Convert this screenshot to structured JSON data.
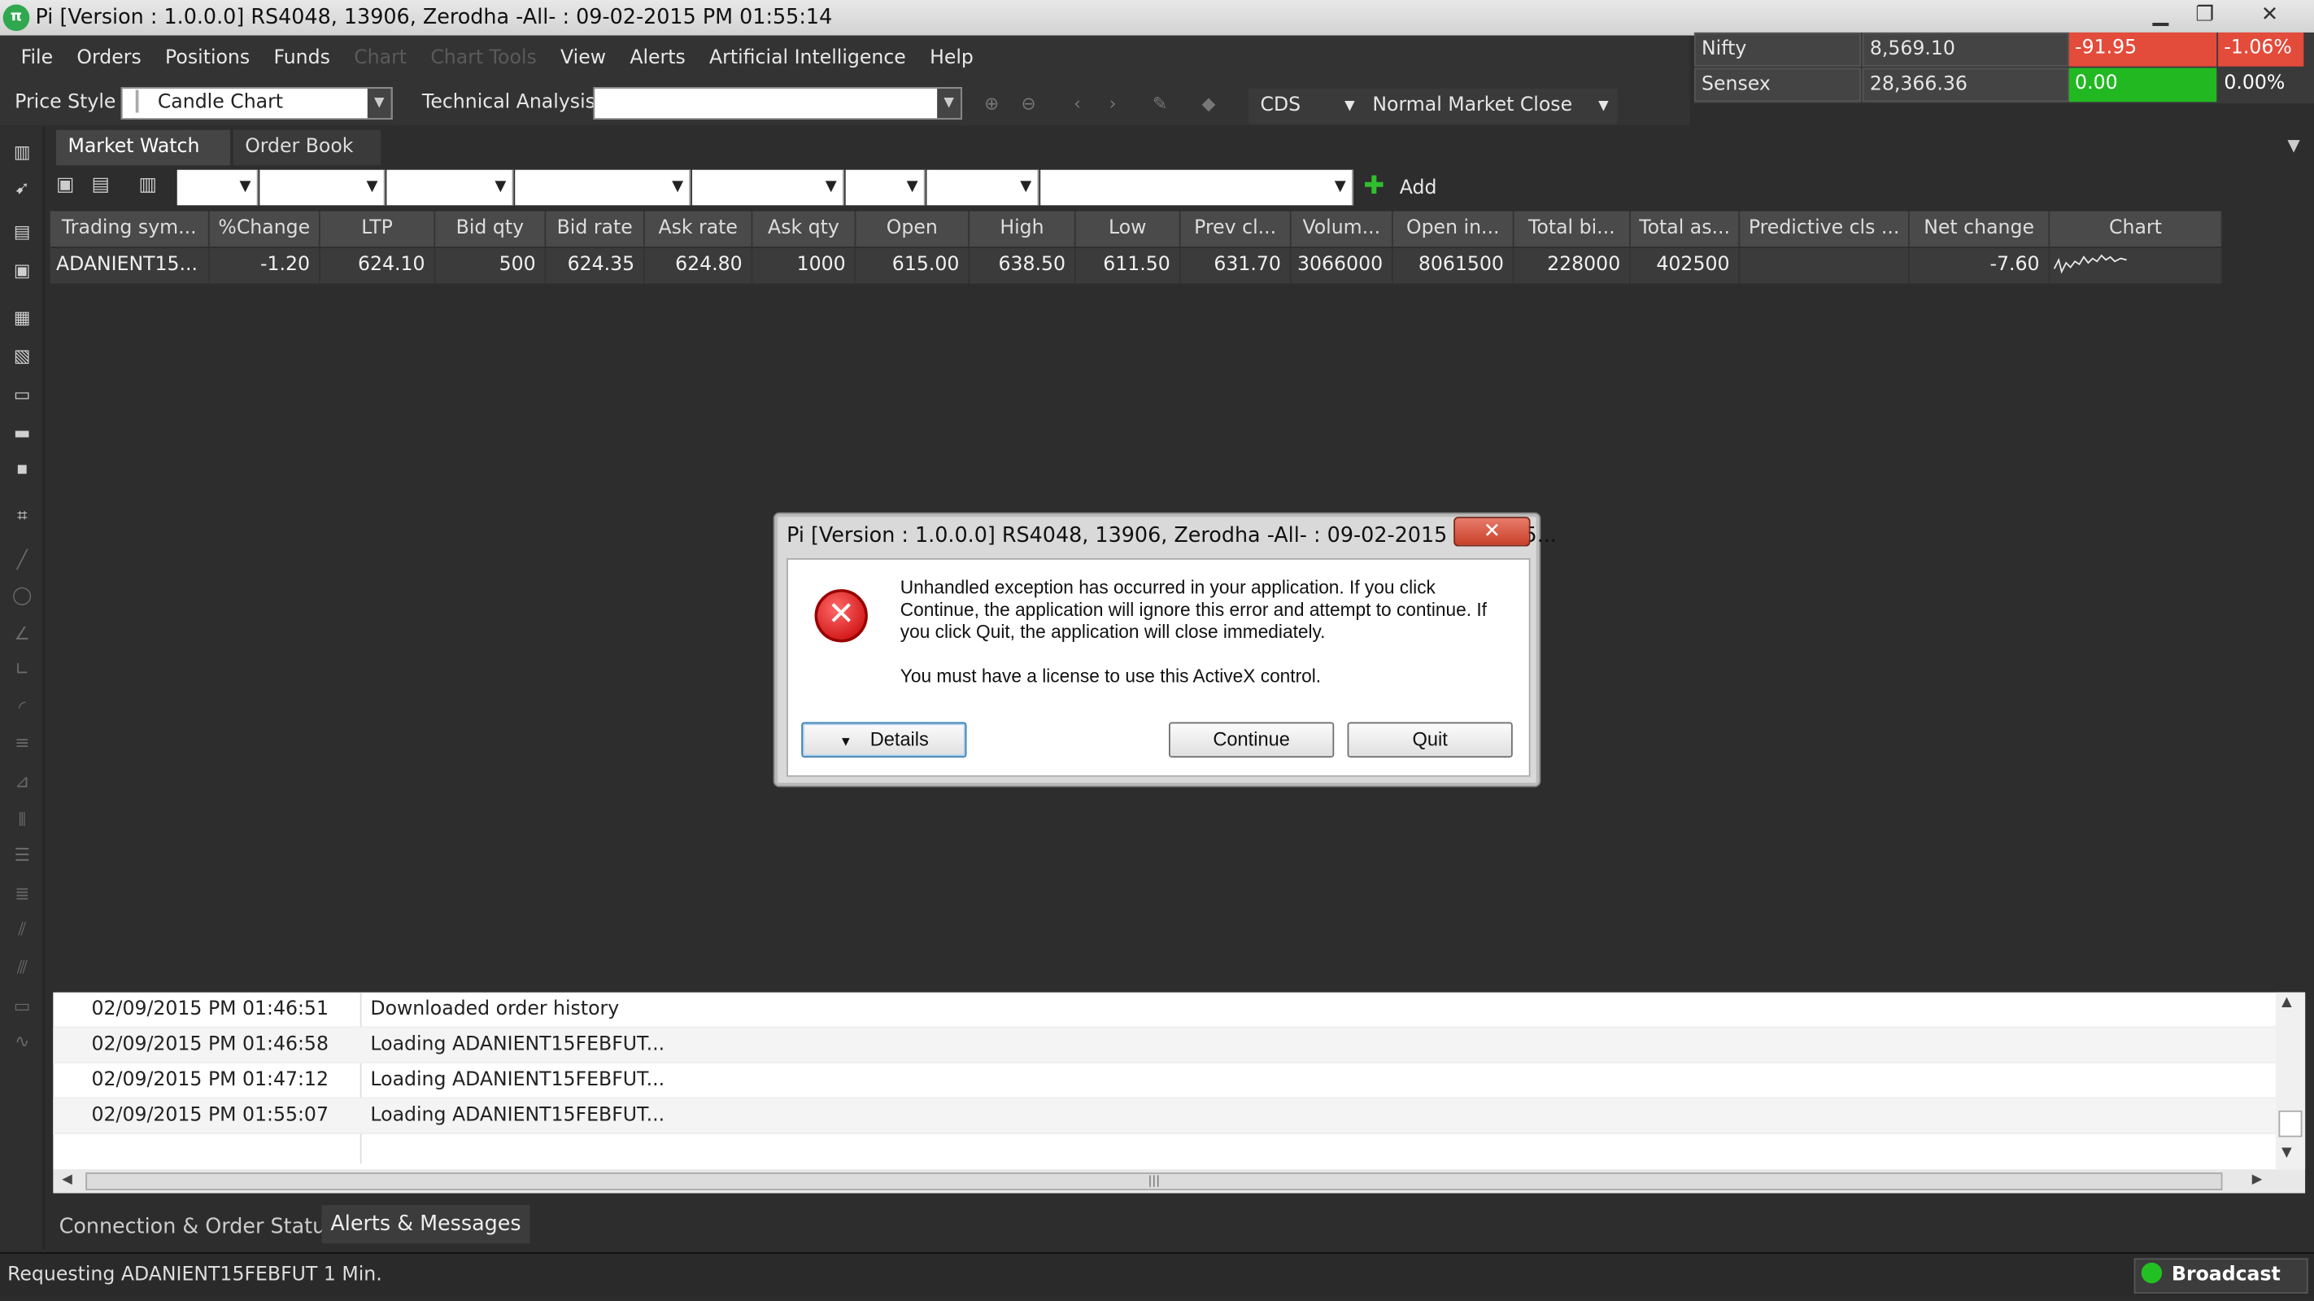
{
  "window": {
    "title": "Pi [Version : 1.0.0.0] RS4048, 13906, Zerodha -All- : 09-02-2015 PM 01:55:14",
    "logo_text": "π"
  },
  "menu": [
    "File",
    "Orders",
    "Positions",
    "Funds",
    "Chart",
    "Chart Tools",
    "View",
    "Alerts",
    "Artificial Intelligence",
    "Help"
  ],
  "menu_disabled": [
    "Chart",
    "Chart Tools"
  ],
  "indices": [
    {
      "name": "Nifty",
      "value": "8,569.10",
      "change": "-91.95",
      "pct": "-1.06%",
      "change_color": "#e34b3b"
    },
    {
      "name": "Sensex",
      "value": "28,366.36",
      "change": "0.00",
      "pct": "0.00%",
      "change_color": "#22b822"
    }
  ],
  "toolbar": {
    "price_style_label": "Price Style",
    "price_style_value": "Candle Chart",
    "technical_label": "Technical Analysis",
    "technical_value": "",
    "exchange_value": "CDS",
    "market_value": "Normal Market Close"
  },
  "tabs": {
    "market_watch": "Market Watch",
    "order_book": "Order Book"
  },
  "filter": {
    "add_label": "Add"
  },
  "grid": {
    "headers": [
      "Trading sym...",
      "%Change",
      "LTP",
      "Bid qty",
      "Bid rate",
      "Ask rate",
      "Ask qty",
      "Open",
      "High",
      "Low",
      "Prev cl...",
      "Volum...",
      "Open in...",
      "Total bi...",
      "Total as...",
      "Predictive cls ...",
      "Net change",
      "Chart"
    ],
    "row": [
      "ADANIENT15...",
      "-1.20",
      "624.10",
      "500",
      "624.35",
      "624.80",
      "1000",
      "615.00",
      "638.50",
      "611.50",
      "631.70",
      "3066000",
      "8061500",
      "228000",
      "402500",
      "",
      "-7.60",
      ""
    ]
  },
  "log": [
    {
      "time": "02/09/2015 PM 01:46:51",
      "msg": "Downloaded order history"
    },
    {
      "time": "02/09/2015 PM 01:46:58",
      "msg": "Loading ADANIENT15FEBFUT..."
    },
    {
      "time": "02/09/2015 PM 01:47:12",
      "msg": "Loading ADANIENT15FEBFUT..."
    },
    {
      "time": "02/09/2015 PM 01:55:07",
      "msg": "Loading ADANIENT15FEBFUT..."
    }
  ],
  "bottom_tabs": {
    "connection": "Connection & Order Status",
    "alerts": "Alerts & Messages"
  },
  "status": {
    "text": "Requesting ADANIENT15FEBFUT 1 Min.",
    "broadcast": "Broadcast"
  },
  "dialog": {
    "title": "Pi [Version : 1.0.0.0] RS4048, 13906, Zerodha -All- : 09-02-2015 PM 01:5...",
    "message_line1": "Unhandled exception has occurred in your application. If you click",
    "message_line2": "Continue, the application will ignore this error and attempt to continue. If",
    "message_line3": "you click Quit, the application will close immediately.",
    "message_line4": "You must have a license to use this ActiveX control.",
    "details_label": "Details",
    "continue_label": "Continue",
    "quit_label": "Quit"
  }
}
